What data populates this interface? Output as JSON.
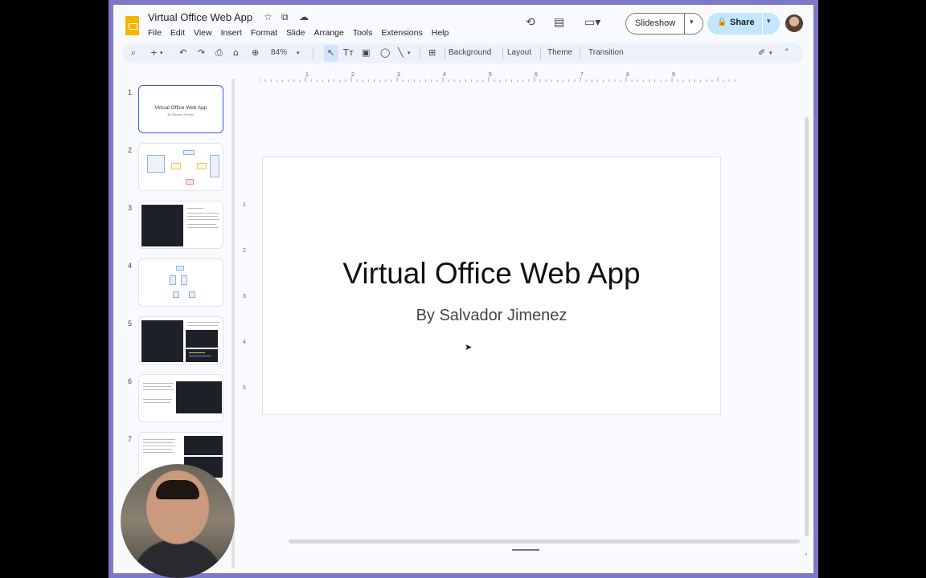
{
  "document": {
    "title": "Virtual Office Web App"
  },
  "menu": [
    "File",
    "Edit",
    "View",
    "Insert",
    "Format",
    "Slide",
    "Arrange",
    "Tools",
    "Extensions",
    "Help"
  ],
  "header_buttons": {
    "slideshow": "Slideshow",
    "share": "Share"
  },
  "toolbar": {
    "zoom": "84%",
    "background": "Background",
    "layout": "Layout",
    "theme": "Theme",
    "transition": "Transition"
  },
  "ruler": {
    "top": [
      "1",
      "2",
      "3",
      "4",
      "5",
      "6",
      "7",
      "8",
      "9"
    ],
    "left": [
      "1",
      "2",
      "3",
      "4",
      "5"
    ]
  },
  "slides": [
    {
      "number": "1",
      "title": "Virtual Office Web App",
      "subtitle": "By Salvador Jimenez",
      "selected": true
    },
    {
      "number": "2"
    },
    {
      "number": "3"
    },
    {
      "number": "4"
    },
    {
      "number": "5"
    },
    {
      "number": "6"
    },
    {
      "number": "7"
    }
  ],
  "current_slide": {
    "title": "Virtual Office Web App",
    "subtitle": "By Salvador Jimenez"
  },
  "colors": {
    "window_frame": "#7c79c9",
    "share_button": "#c2e7ff",
    "selected_thumb_border": "#3b5bdb",
    "slides_logo": "#f5b400"
  },
  "icons": {
    "star": "star-icon",
    "move": "folder-move-icon",
    "cloud": "cloud-status-icon",
    "history": "history-icon",
    "comments": "comments-icon",
    "meet": "video-call-icon"
  }
}
